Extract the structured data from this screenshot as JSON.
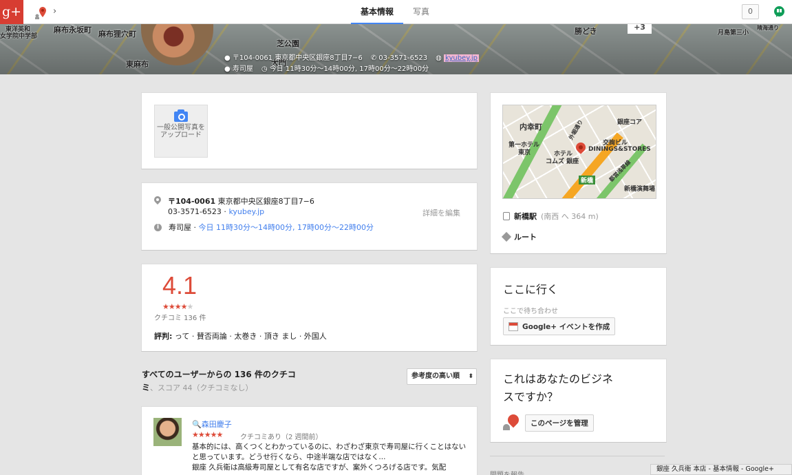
{
  "topbar": {
    "logo": "g+",
    "tabs": [
      {
        "label": "基本情報",
        "active": true
      },
      {
        "label": "写真",
        "active": false
      }
    ],
    "notification_count": "0"
  },
  "banner": {
    "map_labels": [
      "東洋英和",
      "女学院中学部",
      "麻布永坂町",
      "麻布狸穴町",
      "東麻布",
      "芝公園",
      "大門",
      "勝どき",
      "月島第三小",
      "晴海通り"
    ],
    "address": "〒104-0061 東京都中央区銀座8丁目7−6",
    "phone": "03-3571-6523",
    "website": "kyubey.jp",
    "category": "寿司屋",
    "hours": "今日 11時30分～14時00分, 17時00分～22時00分",
    "more_photos": "+3"
  },
  "upload": {
    "label": "一般公開写真をアップロード"
  },
  "info": {
    "postal": "〒104-0061",
    "address": "東京都中央区銀座8丁目7−6",
    "phone": "03-3571-6523",
    "website": "kyubey.jp",
    "edit_label": "詳細を編集",
    "category": "寿司屋",
    "hours": "今日 11時30分～14時00分, 17時00分～22時00分"
  },
  "rating": {
    "score": "4.1",
    "stars_filled": "★★★★",
    "stars_empty": "★",
    "count_label": "クチコミ 136 件",
    "tags_label": "評判:",
    "tags": "って · 賛否両論 · 太巻き · 頂き まし · 外国人"
  },
  "reviews": {
    "heading": "すべてのユーザーからの 136 件のクチコミ",
    "score_note": "、スコア 44（クチコミなし）",
    "sort_label": "参考度の高い順",
    "items": [
      {
        "author": "森田慶子",
        "stars": "★★★★★",
        "meta": "クチコミあり（2 週間前）",
        "body": "基本的には、高くつくとわかっているのに、わざわざ東京で寿司屋に行くことはないと思っています。どうせ行くなら、中途半端な店ではなく...",
        "body2": "銀座 久兵衛は高級寿司屋として有名な店ですが、案外くつろげる店です。気配"
      }
    ]
  },
  "map": {
    "labels": [
      "内幸町",
      "第一ホテル",
      "東京",
      "銀座コア",
      "交詢ビル",
      "DININGS&STORES",
      "ホテル",
      "コムズ 銀座",
      "新橋",
      "新橋演舞場",
      "外堀通り",
      "都営浅草線"
    ],
    "station_name": "新橋駅",
    "station_detail": "(南西 へ 364 m)",
    "route_label": "ルート"
  },
  "goto": {
    "title": "ここに行く",
    "subtitle": "ここで待ち合わせ",
    "button": "Google+ イベントを作成"
  },
  "business": {
    "title": "これはあなたのビジネスですか？",
    "button": "このページを管理"
  },
  "footer": {
    "report": "問題を報告"
  },
  "statusbar": {
    "text": "銀座 久兵衛 本店 - 基本情報 - Google+"
  }
}
